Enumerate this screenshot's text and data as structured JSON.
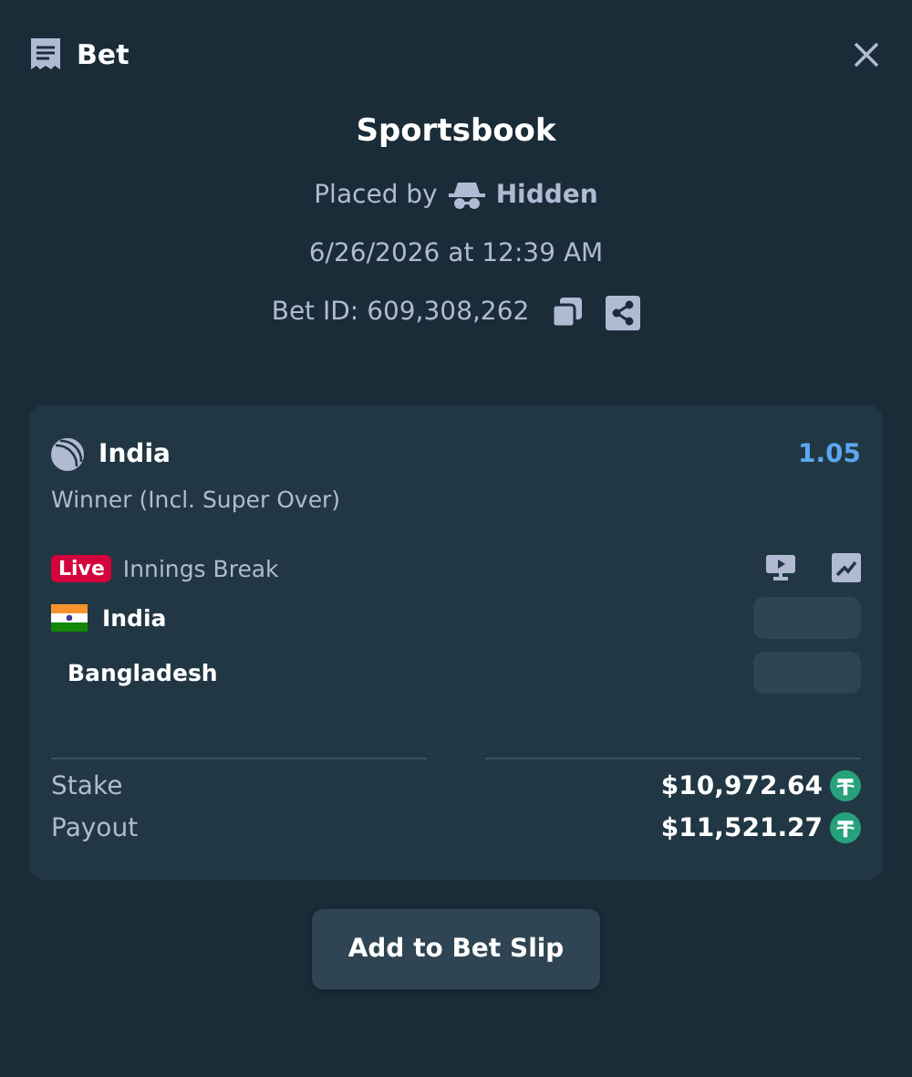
{
  "header": {
    "title": "Bet"
  },
  "summary": {
    "title": "Sportsbook",
    "placed_by_label": "Placed by",
    "user": "Hidden",
    "datetime": "6/26/2026 at 12:39 AM",
    "bet_id": "Bet ID: 609,308,262"
  },
  "selection": {
    "team": "India",
    "odds": "1.05",
    "market": "Winner (Incl. Super Over)",
    "live_badge": "Live",
    "status": "Innings Break",
    "teams": [
      {
        "name": "India",
        "has_flag": true
      },
      {
        "name": "Bangladesh",
        "has_flag": false
      }
    ]
  },
  "totals": [
    {
      "label": "Stake",
      "amount": "$10,972.64"
    },
    {
      "label": "Payout",
      "amount": "$11,521.27"
    }
  ],
  "action": "Add to Bet Slip"
}
